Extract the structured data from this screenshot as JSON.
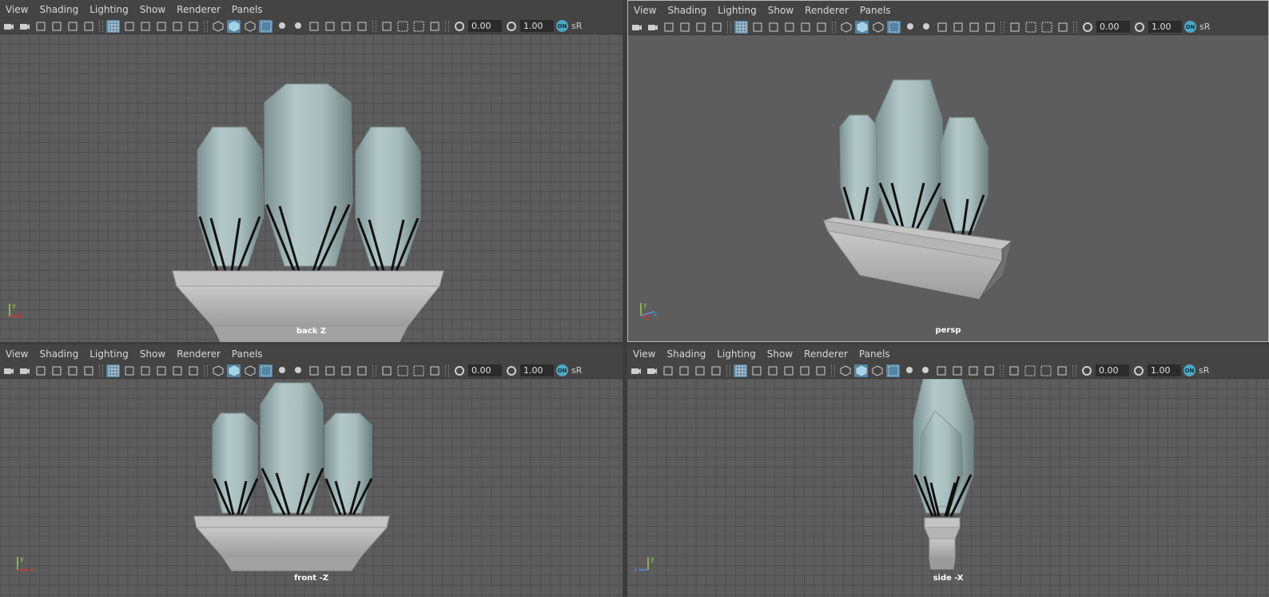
{
  "menu": [
    "View",
    "Shading",
    "Lighting",
    "Show",
    "Renderer",
    "Panels"
  ],
  "toolbar": {
    "exposure": "0.00",
    "gamma": "1.00",
    "color_mode_badge": "ON",
    "color_space": "sR"
  },
  "icons": [
    "camera-icon",
    "camera-attributes-icon",
    "bookmark-icon",
    "image-plane-icon",
    "2d-pan-zoom-icon",
    "grease-pencil-icon",
    "grid-icon",
    "film-gate-icon",
    "resolution-gate-icon",
    "gate-mask-icon",
    "field-chart-icon",
    "safe-title-icon",
    "wireframe-icon",
    "smooth-shade-icon",
    "default-material-icon",
    "xray-icon",
    "use-all-lights-icon",
    "shadows-icon",
    "screen-space-ao-icon",
    "motion-blur-icon",
    "multisample-aa-icon",
    "depth-of-field-icon",
    "isolate-select-icon",
    "xray-joints-icon",
    "xray-active-icon",
    "backface-culling-icon",
    "exposure-icon",
    "gamma-icon",
    "color-management-icon"
  ],
  "panels": {
    "top_left": {
      "label": "back Z",
      "axis_x": "x",
      "axis_y": "y"
    },
    "top_right": {
      "label": "persp",
      "axis_x": "x",
      "axis_y": "y",
      "axis_z": "z"
    },
    "bottom_left": {
      "label": "front -Z",
      "axis_x": "x",
      "axis_y": "y"
    },
    "bottom_right": {
      "label": "side -X",
      "axis_z": "z",
      "axis_y": "y"
    }
  },
  "colors": {
    "panel_bg": "#5d5d5d",
    "menu_bg": "#444444",
    "active_icon_bg": "#5285a6",
    "grid_line": "#4f4f4f",
    "crystal": "#9fb5b5",
    "pot": "#b8b8b8"
  }
}
